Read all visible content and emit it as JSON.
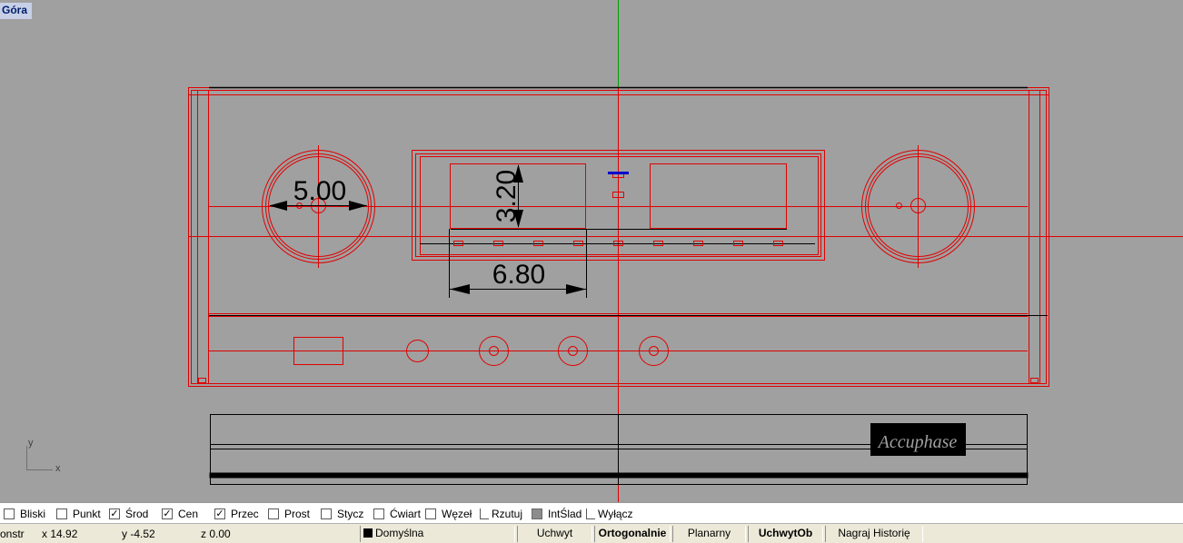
{
  "viewport": {
    "title": "Góra",
    "dimensions": [
      "5.00",
      "3.20",
      "6.80"
    ],
    "logo_text": "Accuphase",
    "axis_labels": {
      "y": "y",
      "x": "x"
    },
    "colors": {
      "background": "#a0a0a0",
      "geometry": "#e00000",
      "dimension": "#000000",
      "axis_y": "#00a000",
      "axis_x": "#c00000",
      "highlight": "#0000cc"
    }
  },
  "snap_bar": {
    "items": [
      {
        "label": "Bliski",
        "checked": false,
        "style": "box"
      },
      {
        "label": "Punkt",
        "checked": false,
        "style": "box"
      },
      {
        "label": "Środ",
        "checked": true,
        "style": "box"
      },
      {
        "label": "Cen",
        "checked": true,
        "style": "box"
      },
      {
        "label": "Przec",
        "checked": true,
        "style": "box"
      },
      {
        "label": "Prost",
        "checked": false,
        "style": "box"
      },
      {
        "label": "Stycz",
        "checked": false,
        "style": "box"
      },
      {
        "label": "Ćwiart",
        "checked": false,
        "style": "box"
      },
      {
        "label": "Węzeł",
        "checked": false,
        "style": "box"
      },
      {
        "label": "Rzutuj",
        "checked": false,
        "style": "flat"
      },
      {
        "label": "IntŚlad",
        "checked": false,
        "style": "gray"
      },
      {
        "label": "Wyłącz",
        "checked": false,
        "style": "flat"
      }
    ]
  },
  "status_bar": {
    "cplane": "onstr",
    "x": "x 14.92",
    "y": "y -4.52",
    "z": "z 0.00",
    "layer": "Domyślna",
    "layer_color": "#000000",
    "panes": [
      {
        "label": "Uchwyt",
        "active": false
      },
      {
        "label": "Ortogonalnie",
        "active": true
      },
      {
        "label": "Planarny",
        "active": false
      },
      {
        "label": "UchwytOb",
        "active": true
      },
      {
        "label": "Nagraj Historię",
        "active": false
      }
    ]
  }
}
